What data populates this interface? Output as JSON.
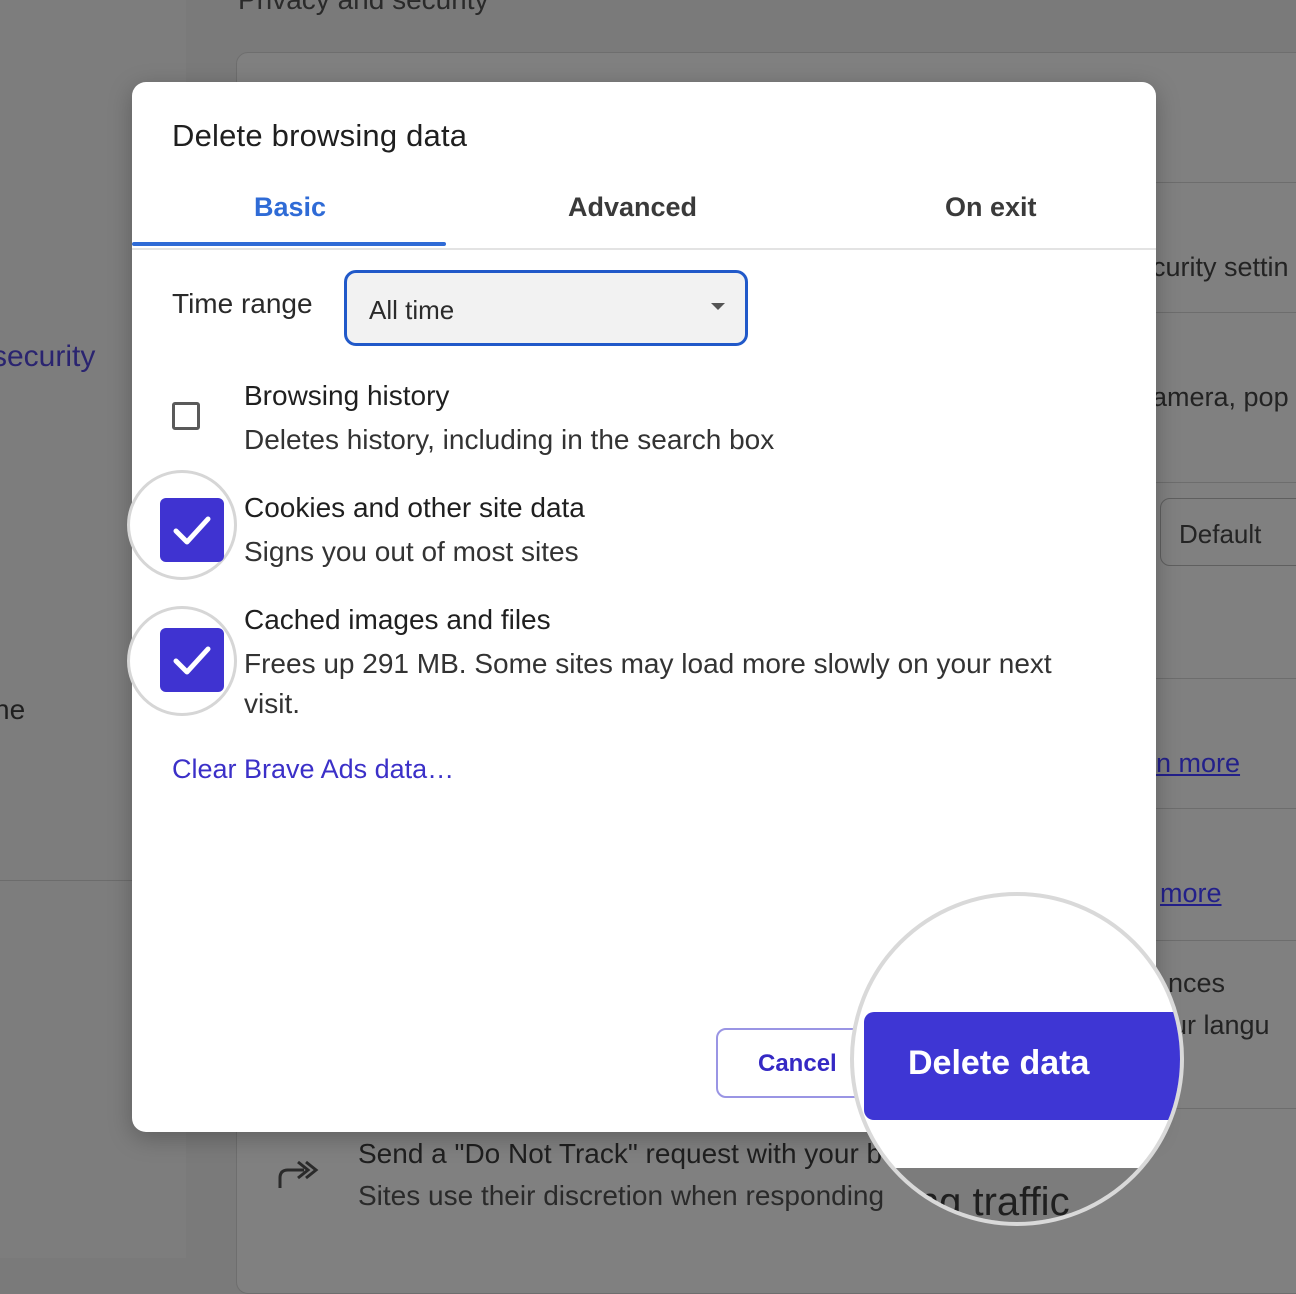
{
  "background": {
    "section_title": "Privacy and security",
    "nav": {
      "security": "security",
      "other": "ne"
    },
    "rows": [
      "curity settin",
      "amera, pop",
      "nces",
      "ur langu"
    ],
    "select_value": "Default",
    "links": [
      "n more",
      "more"
    ],
    "do_not_track": {
      "icon": "forward-arrows-icon",
      "title": "Send a \"Do Not Track\" request with your b",
      "description": "Sites use their discretion when responding"
    }
  },
  "dialog": {
    "title": "Delete browsing data",
    "tabs": [
      {
        "label": "Basic",
        "selected": true
      },
      {
        "label": "Advanced",
        "selected": false
      },
      {
        "label": "On exit",
        "selected": false
      }
    ],
    "time_range": {
      "label": "Time range",
      "value": "All time"
    },
    "options": [
      {
        "title": "Browsing history",
        "description": "Deletes history, including in the search box",
        "checked": false
      },
      {
        "title": "Cookies and other site data",
        "description": "Signs you out of most sites",
        "checked": true
      },
      {
        "title": "Cached images and files",
        "description": "Frees up 291 MB. Some sites may load more slowly on your next visit.",
        "checked": true
      }
    ],
    "ads_link": "Clear Brave Ads data…",
    "buttons": {
      "cancel": "Cancel",
      "delete": "Delete data"
    }
  },
  "magnifier": {
    "underlay_text": "ing traffic"
  },
  "colors": {
    "accent": "#3f33d1",
    "tab_blue": "#2f6bd6",
    "select_border": "#2159c9"
  }
}
